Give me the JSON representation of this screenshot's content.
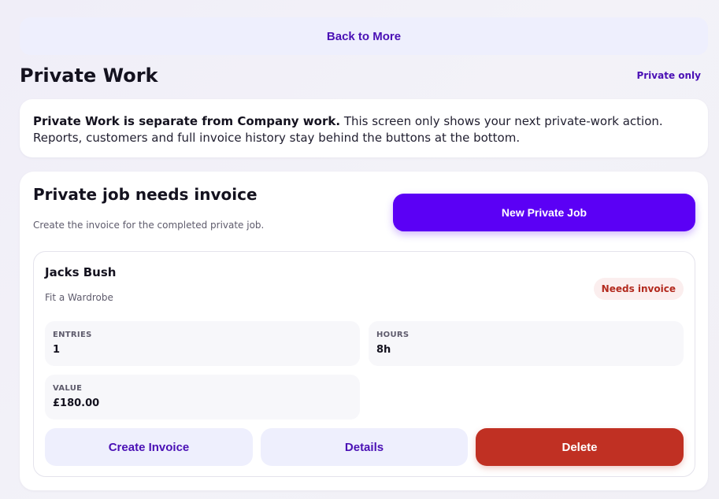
{
  "nav": {
    "back_label": "Back to More"
  },
  "header": {
    "title": "Private Work",
    "mode_badge": "Private only"
  },
  "intro": {
    "bold": "Private Work is separate from Company work.",
    "text": " This screen only shows your next private-work action. Reports, customers and full invoice history stay behind the buttons at the bottom."
  },
  "section": {
    "title": "Private job needs invoice",
    "subtitle": "Create the invoice for the completed private job.",
    "new_job_label": "New Private Job"
  },
  "job": {
    "name": "Jacks Bush",
    "description": "Fit a Wardrobe",
    "status": "Needs invoice",
    "stats": {
      "entries": {
        "label": "ENTRIES",
        "value": "1"
      },
      "hours": {
        "label": "HOURS",
        "value": "8h"
      },
      "value": {
        "label": "VALUE",
        "value": "£180.00"
      }
    },
    "actions": {
      "create_invoice": "Create Invoice",
      "details": "Details",
      "delete": "Delete"
    }
  },
  "colors": {
    "accent": "#5b00f5",
    "accent_text": "#4a10b5",
    "danger": "#c03023",
    "soft_button": "#eeeffd",
    "badge_bg": "#fbeeee"
  }
}
